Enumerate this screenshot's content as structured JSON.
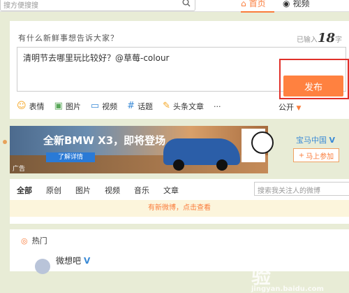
{
  "topbar": {
    "search_placeholder": "搜方便搜搜",
    "nav_home_label": "首页",
    "nav_video_label": "视频"
  },
  "composer": {
    "prompt": "有什么新鲜事想告诉大家？",
    "count_prefix": "已输入",
    "count_value": "18",
    "count_suffix": "字",
    "text": "清明节去哪里玩比较好？@草莓-colour",
    "tools": {
      "emoji": "表情",
      "image": "图片",
      "video": "视频",
      "topic": "话题",
      "article": "头条文章",
      "more": "···"
    },
    "visibility": "公开",
    "publish": "发布"
  },
  "ad": {
    "headline": "全新BMW X3，即将登场",
    "cta": "了解详情",
    "tag": "广告",
    "brand": "宝马中国",
    "follow": "马上参加"
  },
  "feed": {
    "filters": [
      "全部",
      "原创",
      "图片",
      "视频",
      "音乐",
      "文章"
    ],
    "search_placeholder": "搜索我关注人的微博",
    "new_tip": "有新微博，点击查看",
    "hot_label": "热门",
    "hot_user": "微想吧"
  },
  "watermark": {
    "brand": "Baidu经验",
    "url": "jingyan.baidu.com"
  },
  "colors": {
    "accent": "#fa7d3c",
    "publish": "#ff8140",
    "highlight_box": "#e0302a",
    "link_blue": "#3a8ad6"
  }
}
